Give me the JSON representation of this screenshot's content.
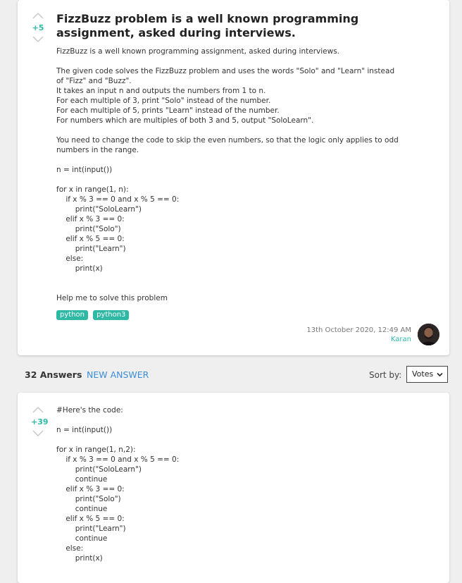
{
  "question": {
    "score": "+5",
    "title": "FizzBuzz problem is a well known programming assignment, asked during interviews.",
    "body_lines": [
      "FizzBuzz is a well known programming assignment, asked during interviews.",
      "",
      "The given code solves the FizzBuzz problem and uses the words \"Solo\" and \"Learn\" instead",
      "of \"Fizz\" and \"Buzz\".",
      "It takes an input n and outputs the numbers from 1 to n.",
      "For each multiple of 3, print \"Solo\" instead of the number.",
      "For each multiple of 5, prints \"Learn\" instead of the number.",
      "For numbers which are multiples of both 3 and 5, output \"SoloLearn\".",
      "",
      "You need to change the code to skip the even numbers, so that the logic only applies to odd",
      "numbers in the range.",
      "",
      "n = int(input())",
      "",
      "for x in range(1, n):",
      "    if x % 3 == 0 and x % 5 == 0:",
      "        print(\"SoloLearn\")",
      "    elif x % 3 == 0:",
      "        print(\"Solo\")",
      "    elif x % 5 == 0:",
      "        print(\"Learn\")",
      "    else:",
      "        print(x)",
      "",
      "",
      "Help me to solve this problem"
    ],
    "tags": [
      "python",
      "python3"
    ],
    "date": "13th October 2020, 12:49 AM",
    "author": "Karan"
  },
  "answers_bar": {
    "count_label": "32 Answers",
    "new_answer_label": "NEW ANSWER",
    "sort_label": "Sort by:",
    "sort_value": "Votes"
  },
  "answer": {
    "score": "+39",
    "body_lines": [
      "#Here's the code:",
      "",
      "n = int(input())",
      "",
      "for x in range(1, n,2):",
      "    if x % 3 == 0 and x % 5 == 0:",
      "        print(\"SoloLearn\")",
      "        continue",
      "    elif x % 3 == 0:",
      "        print(\"Solo\")",
      "        continue",
      "    elif x % 5 == 0:",
      "        print(\"Learn\")",
      "        continue",
      "    else:",
      "        print(x)"
    ]
  }
}
